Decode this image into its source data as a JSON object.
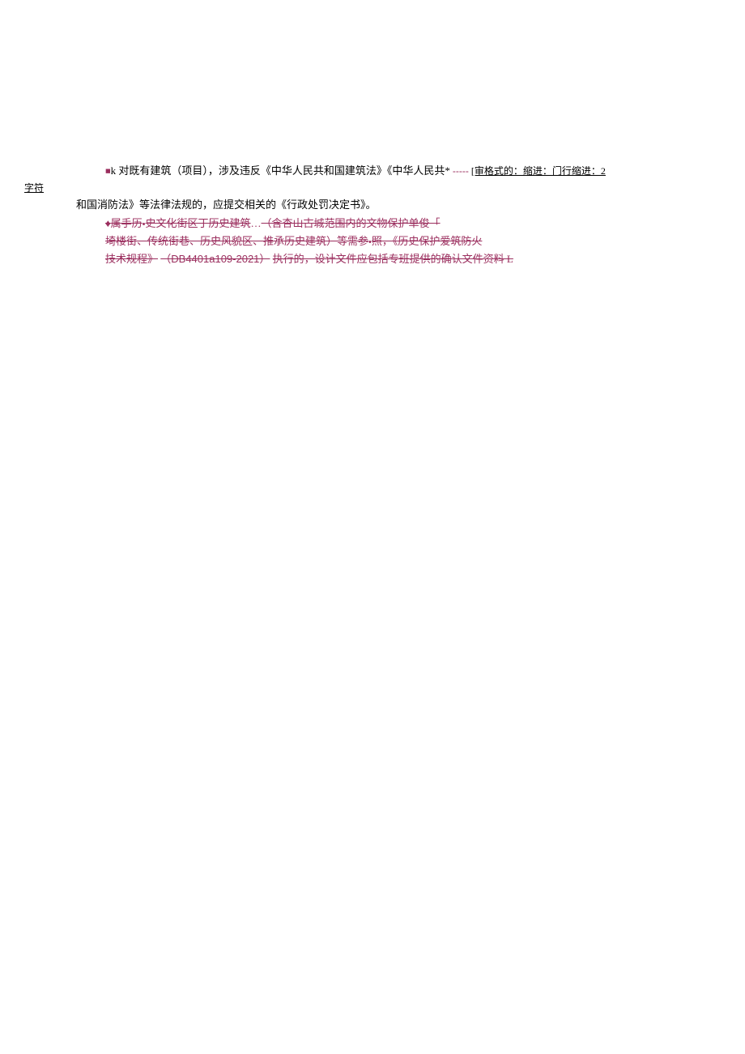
{
  "line1": {
    "marker": "■",
    "ksym": "k",
    "text_a": "对既有建筑（项目），涉及违反《中华人民共和国建筑法》《中华人民共",
    "star": "*",
    "dashes": "-----",
    "comment_prefix": "[审格式的：缩进：门行缩进：2"
  },
  "zifu": "字符",
  "line2": "和国消防法》等法律法规的，应提交相关的《行政处罚决定书》。",
  "deleted": {
    "l1": {
      "diamond": "♦",
      "a": "属手历",
      "b": "史文化街区丁历史建筑",
      "ell": "…",
      "c": "（含杏山古城范围内的文物保护单俊「"
    },
    "l2": {
      "a": "埼楼街、传统街巷、历史风貌区、推承历史建筑）等需参",
      "b": "照，《历史保护爱筑防火"
    },
    "l3": {
      "a": "技术规程》",
      "std": "（DB4401a109-2021）",
      "b": "执行的，设计文件应包括专班提供的确认文件资料 L"
    }
  }
}
